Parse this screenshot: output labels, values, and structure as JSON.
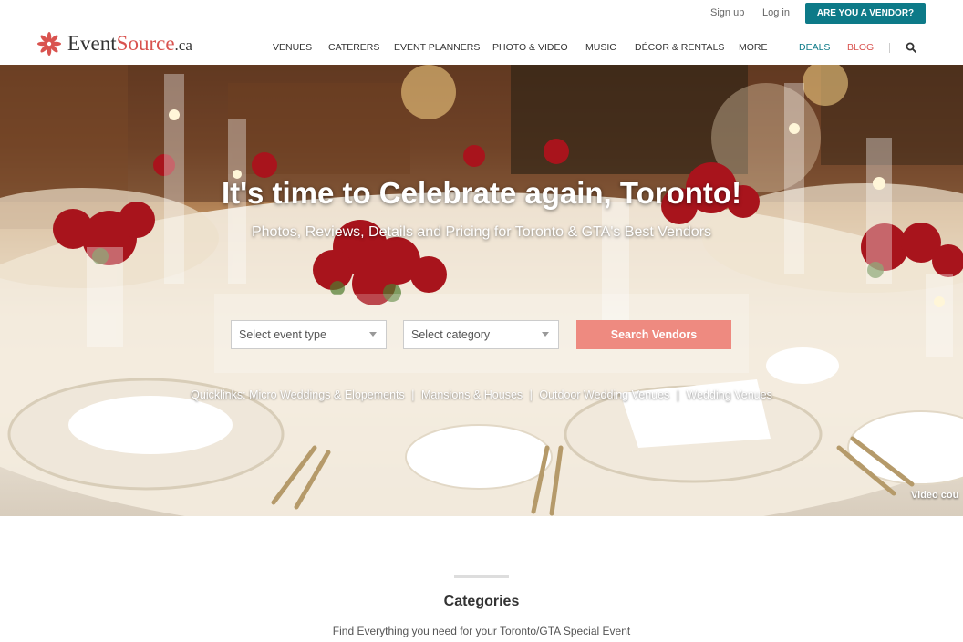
{
  "topbar": {
    "signup_label": "Sign up",
    "login_label": "Log in",
    "vendor_button_label": "ARE YOU A VENDOR?"
  },
  "logo": {
    "text_event": "Event",
    "text_source": "Source",
    "text_ca": ".ca",
    "icon": "flower-icon"
  },
  "nav": {
    "items": [
      {
        "label": "VENUES"
      },
      {
        "label": "CATERERS"
      },
      {
        "label": "EVENT PLANNERS"
      },
      {
        "label": "PHOTO & VIDEO"
      },
      {
        "label": "MUSIC"
      },
      {
        "label": "DÉCOR & RENTALS"
      },
      {
        "label": "MORE"
      },
      {
        "label": "DEALS"
      },
      {
        "label": "BLOG"
      }
    ],
    "search_icon": "search-icon"
  },
  "hero": {
    "title": "It's time to Celebrate again, Toronto!",
    "subtitle": "Photos, Reviews, Details and Pricing for Toronto & GTA's Best Vendors",
    "event_type_placeholder": "Select event type",
    "category_placeholder": "Select category",
    "search_button_label": "Search Vendors",
    "quicklinks_prefix": "Quicklinks:",
    "quicklinks": [
      "Micro Weddings & Elopements",
      "Mansions & Houses",
      "Outdoor Wedding Venues",
      "Wedding Venues"
    ],
    "video_credit": "Video cou"
  },
  "categories": {
    "title": "Categories",
    "subtitle": "Find Everything you need for your Toronto/GTA Special Event"
  },
  "colors": {
    "brand_teal": "#0d7a88",
    "brand_red": "#d9534f",
    "search_button": "#ee8a80"
  }
}
